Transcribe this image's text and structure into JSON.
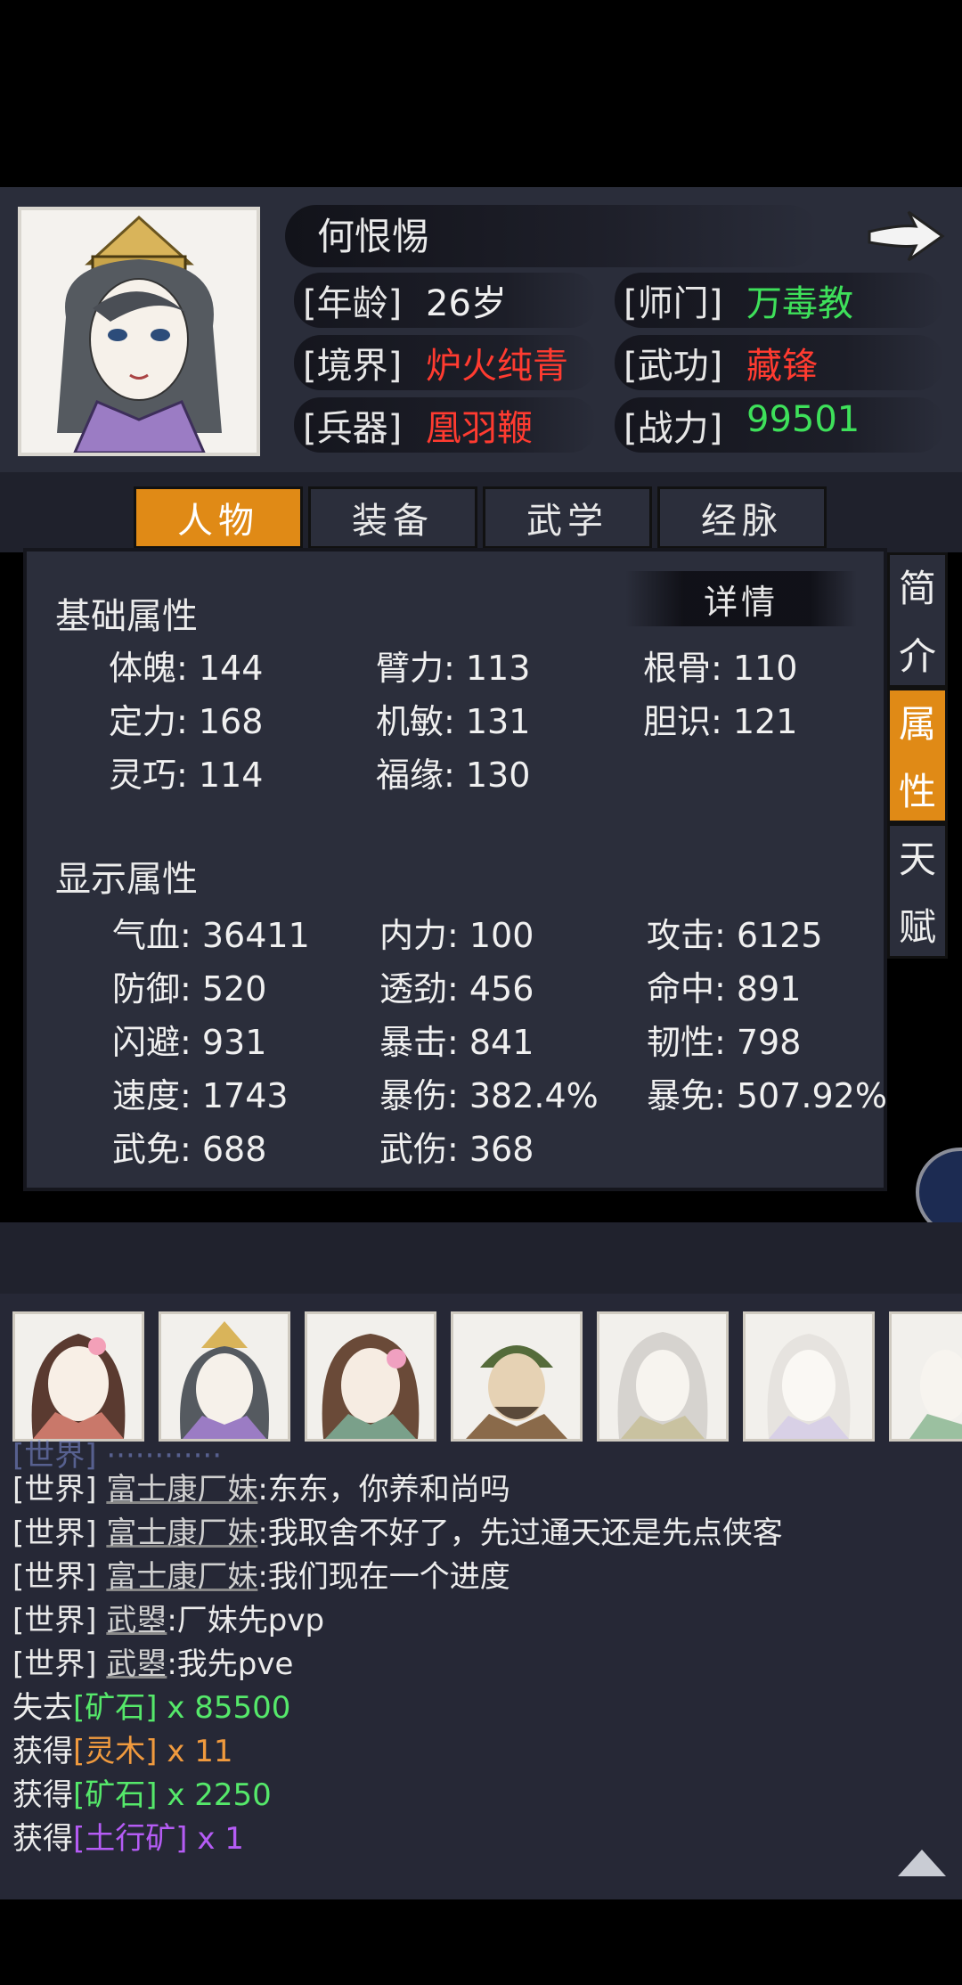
{
  "character": {
    "name": "何恨惕",
    "info": [
      {
        "label": "[年龄]",
        "value": "26岁",
        "color": "white"
      },
      {
        "label": "[师门]",
        "value": "万毒教",
        "color": "green"
      },
      {
        "label": "[境界]",
        "value": "炉火纯青",
        "color": "red"
      },
      {
        "label": "[武功]",
        "value": "藏锋",
        "color": "red"
      },
      {
        "label": "[兵器]",
        "value": "凰羽鞭",
        "color": "red"
      },
      {
        "label": "[战力]",
        "value": "99501",
        "color": "green"
      }
    ]
  },
  "tabs": [
    "人物",
    "装备",
    "武学",
    "经脉"
  ],
  "active_tab": "人物",
  "side_tabs": [
    "简介",
    "属性",
    "天赋"
  ],
  "active_side_tab": "属性",
  "basic_attrs": {
    "title": "基础属性",
    "detail_label": "详情",
    "stats": [
      "体魄: 144",
      "臂力: 113",
      "根骨: 110",
      "定力: 168",
      "机敏: 131",
      "胆识: 121",
      "灵巧: 114",
      "福缘: 130"
    ]
  },
  "display_attrs": {
    "title": "显示属性",
    "stats": [
      "气血: 36411",
      "内力: 100",
      "攻击: 6125",
      "防御: 520",
      "透劲: 456",
      "命中: 891",
      "闪避: 931",
      "暴击: 841",
      "韧性: 798",
      "速度: 1743",
      "暴伤: 382.4%",
      "暴免: 507.92%",
      "武免: 688",
      "武伤: 368"
    ]
  },
  "chat": {
    "messages": [
      {
        "channel": "[世界]",
        "sender": "富士康厂妹",
        "text": ":东东，你养和尚吗"
      },
      {
        "channel": "[世界]",
        "sender": "富士康厂妹",
        "text": ":我取舍不好了，先过通天还是先点侠客"
      },
      {
        "channel": "[世界]",
        "sender": "富士康厂妹",
        "text": ":我们现在一个进度"
      },
      {
        "channel": "[世界]",
        "sender": "武曌",
        "text": ":厂妹先pvp"
      },
      {
        "channel": "[世界]",
        "sender": "武曌",
        "text": ":我先pve"
      }
    ],
    "loot": [
      {
        "verb": "失去",
        "item": "[矿石]",
        "qty": "x 85500",
        "color": "green"
      },
      {
        "verb": "获得",
        "item": "[灵木]",
        "qty": "x 11",
        "color": "orange"
      },
      {
        "verb": "获得",
        "item": "[矿石]",
        "qty": "x 2250",
        "color": "green"
      },
      {
        "verb": "获得",
        "item": "[土行矿]",
        "qty": "x 1",
        "color": "purple"
      }
    ]
  },
  "icons": {
    "next": "right-arrow-icon",
    "scroll_up": "triangle-up-icon"
  },
  "colors": {
    "accent": "#e08a16",
    "panel": "#2b2e3b",
    "red": "#ff3b30",
    "green": "#3ee05a"
  }
}
